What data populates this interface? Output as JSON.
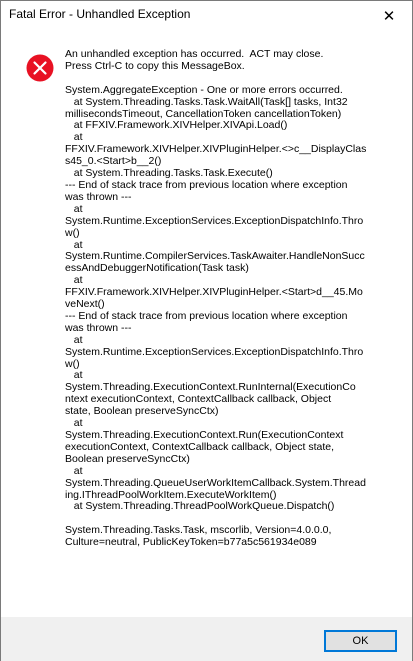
{
  "window": {
    "title": "Fatal Error - Unhandled Exception",
    "close_symbol": "✕"
  },
  "icons": {
    "error": "error-icon",
    "close": "close-icon"
  },
  "colors": {
    "error_red": "#e81123",
    "button_border": "#0078d7",
    "footer_bg": "#f0f0f0"
  },
  "message": {
    "text": "An unhandled exception has occurred.  ACT may close.\nPress Ctrl-C to copy this MessageBox.\n\nSystem.AggregateException - One or more errors occurred.\n   at System.Threading.Tasks.Task.WaitAll(Task[] tasks, Int32\nmillisecondsTimeout, CancellationToken cancellationToken)\n   at FFXIV.Framework.XIVHelper.XIVApi.Load()\n   at\nFFXIV.Framework.XIVHelper.XIVPluginHelper.<>c__DisplayClas\ns45_0.<Start>b__2()\n   at System.Threading.Tasks.Task.Execute()\n--- End of stack trace from previous location where exception\nwas thrown ---\n   at\nSystem.Runtime.ExceptionServices.ExceptionDispatchInfo.Thro\nw()\n   at\nSystem.Runtime.CompilerServices.TaskAwaiter.HandleNonSucc\nessAndDebuggerNotification(Task task)\n   at\nFFXIV.Framework.XIVHelper.XIVPluginHelper.<Start>d__45.Mo\nveNext()\n--- End of stack trace from previous location where exception\nwas thrown ---\n   at\nSystem.Runtime.ExceptionServices.ExceptionDispatchInfo.Thro\nw()\n   at\nSystem.Threading.ExecutionContext.RunInternal(ExecutionCo\nntext executionContext, ContextCallback callback, Object\nstate, Boolean preserveSyncCtx)\n   at\nSystem.Threading.ExecutionContext.Run(ExecutionContext\nexecutionContext, ContextCallback callback, Object state,\nBoolean preserveSyncCtx)\n   at\nSystem.Threading.QueueUserWorkItemCallback.System.Thread\ning.IThreadPoolWorkItem.ExecuteWorkItem()\n   at System.Threading.ThreadPoolWorkQueue.Dispatch()\n\nSystem.Threading.Tasks.Task, mscorlib, Version=4.0.0.0,\nCulture=neutral, PublicKeyToken=b77a5c561934e089"
  },
  "buttons": {
    "ok_label": "OK"
  }
}
